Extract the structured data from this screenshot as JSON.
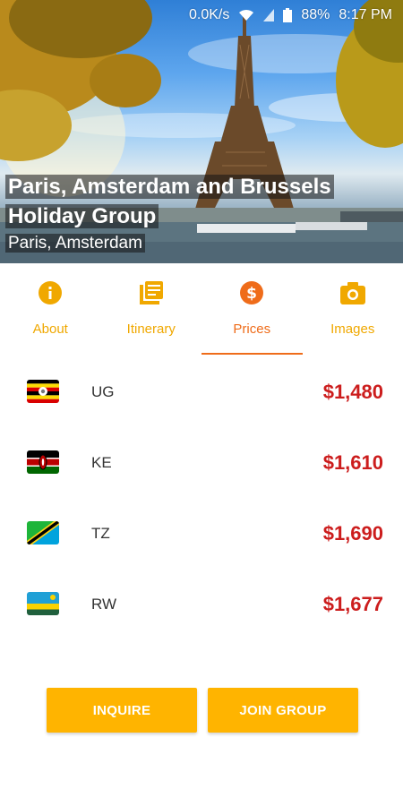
{
  "status_bar": {
    "speed": "0.0K/s",
    "battery": "88%",
    "time": "8:17 PM"
  },
  "hero": {
    "title": "Paris, Amsterdam and Brussels Holiday Group",
    "subtitle": "Paris, Amsterdam"
  },
  "tabs": [
    {
      "label": "About",
      "icon": "info-icon",
      "active": false
    },
    {
      "label": "Itinerary",
      "icon": "itinerary-icon",
      "active": false
    },
    {
      "label": "Prices",
      "icon": "dollar-icon",
      "active": true
    },
    {
      "label": "Images",
      "icon": "camera-icon",
      "active": false
    }
  ],
  "prices": [
    {
      "code": "UG",
      "flag": "uganda-flag",
      "price": "$1,480"
    },
    {
      "code": "KE",
      "flag": "kenya-flag",
      "price": "$1,610"
    },
    {
      "code": "TZ",
      "flag": "tanzania-flag",
      "price": "$1,690"
    },
    {
      "code": "RW",
      "flag": "rwanda-flag",
      "price": "$1,677"
    }
  ],
  "buttons": {
    "inquire": "INQUIRE",
    "join": "JOIN GROUP"
  },
  "colors": {
    "accent": "#ffb400",
    "tab_inactive": "#f0a800",
    "tab_active": "#ef6c1a",
    "price": "#cc1d1d"
  }
}
